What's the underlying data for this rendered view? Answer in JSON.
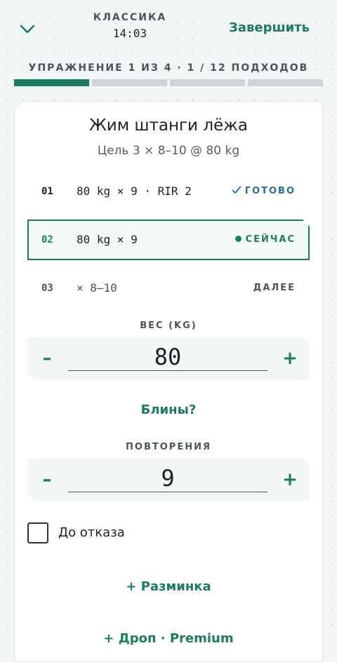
{
  "header": {
    "mode": "КЛАССИКА",
    "timer": "14:03",
    "finish_label": "Завершить"
  },
  "progress": {
    "label": "УПРАЖНЕНИЕ 1 ИЗ 4 · 1 / 12 ПОДХОДОВ",
    "exercises_total": 4,
    "exercise_current": 1
  },
  "exercise": {
    "title": "Жим штанги лёжа",
    "goal": "Цель 3 × 8–10 @ 80 kg",
    "sets": [
      {
        "num": "01",
        "text": "80 kg × 9 · RIR 2",
        "status": "ГОТОВО",
        "state": "done"
      },
      {
        "num": "02",
        "text": "80 kg × 9",
        "status": "СЕЙЧАС",
        "state": "current"
      },
      {
        "num": "03",
        "text": "× 8–10",
        "status": "ДАЛЕЕ",
        "state": "next"
      }
    ]
  },
  "weight": {
    "label": "ВЕС (KG)",
    "value": "80",
    "minus": "–",
    "plus": "+"
  },
  "plates_link": "Блины?",
  "reps": {
    "label": "ПОВТОРЕНИЯ",
    "value": "9",
    "minus": "–",
    "plus": "+"
  },
  "to_failure": {
    "label": "До отказа",
    "checked": false
  },
  "warmup_link": "+ Разминка",
  "drop_link": "+ Дроп · Premium",
  "colors": {
    "accent": "#1f7a63",
    "done": "#2a6c9a",
    "muted": "#4b5558",
    "background": "#f3f6f6"
  },
  "icons": {
    "collapse": "chevron-down-icon",
    "done": "check-icon",
    "current": "dot-icon"
  }
}
